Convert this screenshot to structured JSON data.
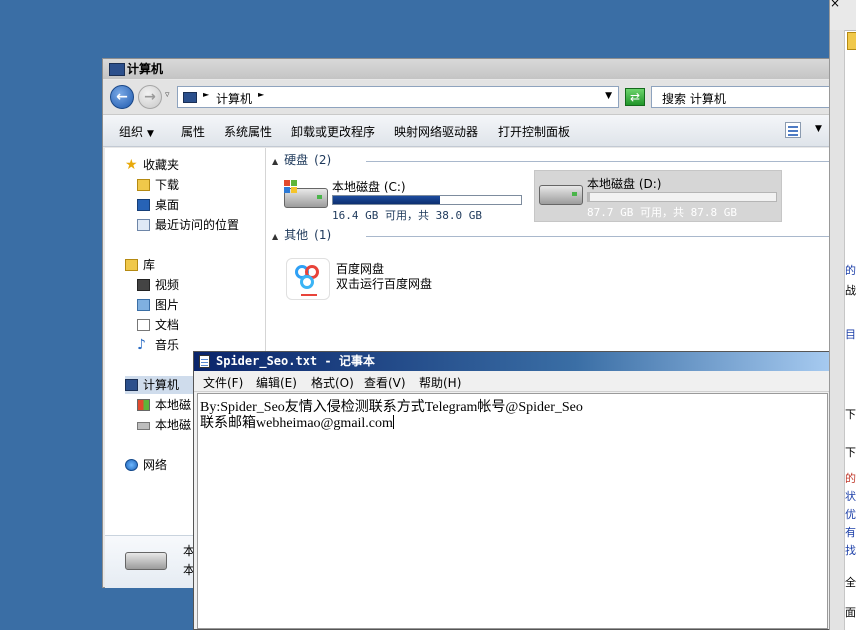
{
  "explorer": {
    "title": "计算机",
    "address": {
      "path": "计算机"
    },
    "search_placeholder": "搜索 计算机",
    "toolbar": {
      "organize": "组织",
      "properties": "属性",
      "system_properties": "系统属性",
      "uninstall": "卸载或更改程序",
      "map_drive": "映射网络驱动器",
      "control_panel": "打开控制面板"
    },
    "nav": {
      "favorites": "收藏夹",
      "downloads": "下载",
      "desktop": "桌面",
      "recent": "最近访问的位置",
      "libraries": "库",
      "videos": "视频",
      "pictures": "图片",
      "documents": "文档",
      "music": "音乐",
      "computer": "计算机",
      "drive_c": "本地磁",
      "drive_d": "本地磁",
      "network": "网络"
    },
    "groups": {
      "hard_disks": {
        "label": "硬盘",
        "count": "(2)"
      },
      "other": {
        "label": "其他",
        "count": "(1)"
      }
    },
    "drives": [
      {
        "name": "本地磁盘 (C:)",
        "free_text": "16.4 GB 可用，共 38.0 GB",
        "used_fraction": 0.57
      },
      {
        "name": "本地磁盘 (D:)",
        "free_text": "87.7 GB 可用，共 87.8 GB",
        "used_fraction": 0.01
      }
    ],
    "apps": [
      {
        "name": "百度网盘",
        "desc": "双击运行百度网盘"
      }
    ],
    "details": {
      "line1": "本",
      "line2": "本"
    }
  },
  "notepad": {
    "title": "Spider_Seo.txt - 记事本",
    "menu": {
      "file": "文件(F)",
      "edit": "编辑(E)",
      "format": "格式(O)",
      "view": "查看(V)",
      "help": "帮助(H)"
    },
    "content": {
      "line1": "By:Spider_Seo友情入侵检测联系方式Telegram帐号@Spider_Seo",
      "line2": "联系邮箱webheimao@gmail.com"
    }
  },
  "background_window": {
    "close_glyph": "×",
    "fragments": [
      "的",
      "战",
      "目",
      "下",
      "下",
      "的",
      "状",
      "优",
      "有",
      "找",
      "全",
      "面"
    ]
  }
}
